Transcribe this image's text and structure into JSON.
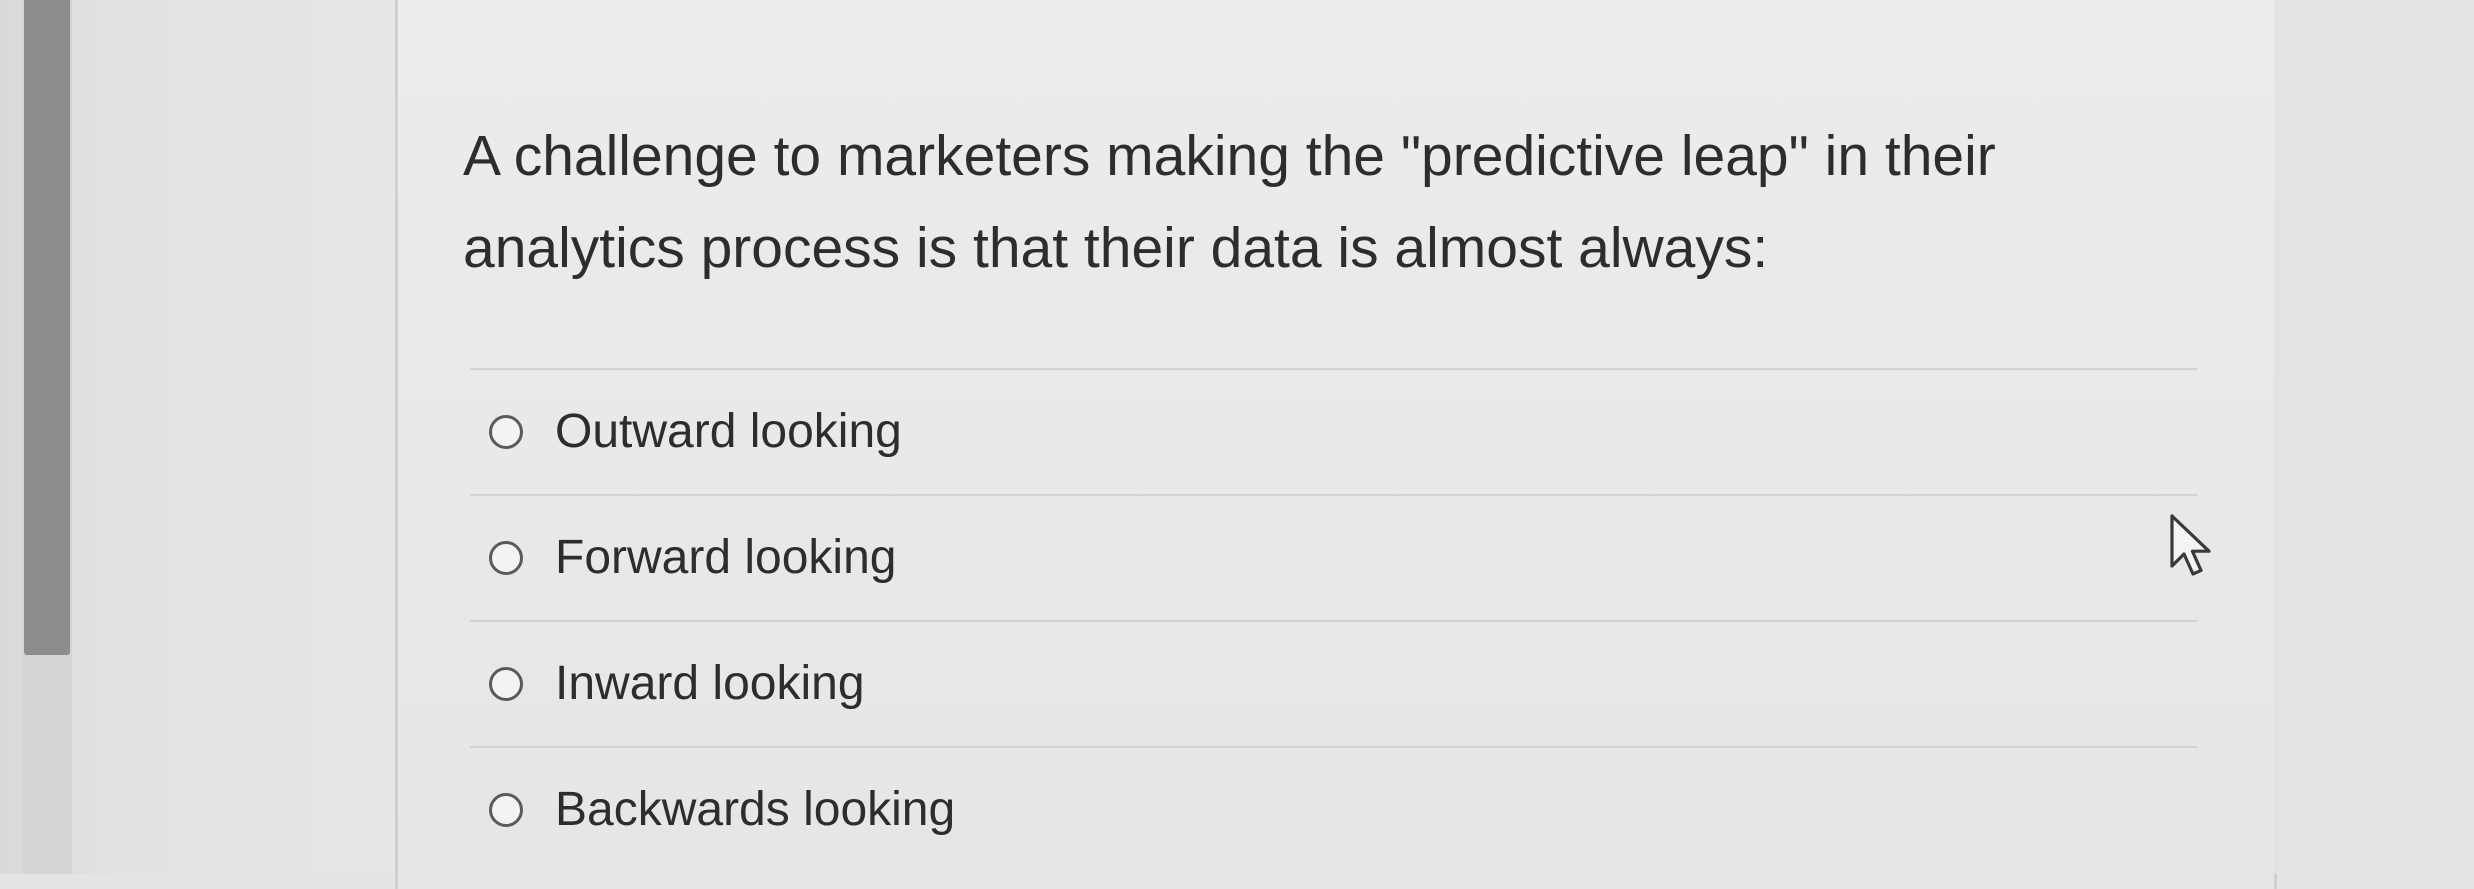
{
  "question": {
    "text": "A challenge to marketers making the \"predictive leap\" in their analytics process is that their data is almost always:"
  },
  "answers": [
    {
      "label": "Outward looking",
      "selected": false
    },
    {
      "label": "Forward looking",
      "selected": false
    },
    {
      "label": "Inward looking",
      "selected": false
    },
    {
      "label": "Backwards looking",
      "selected": false
    }
  ],
  "icons": {
    "cursor": "mouse-pointer-icon",
    "radio": "radio-button-unchecked-icon"
  },
  "colors": {
    "background": "#e4e4e2",
    "card": "#ebebe9",
    "text": "#2d2d2d",
    "divider": "#d3d3d1",
    "scrollbar_thumb": "#8d8d8c"
  }
}
